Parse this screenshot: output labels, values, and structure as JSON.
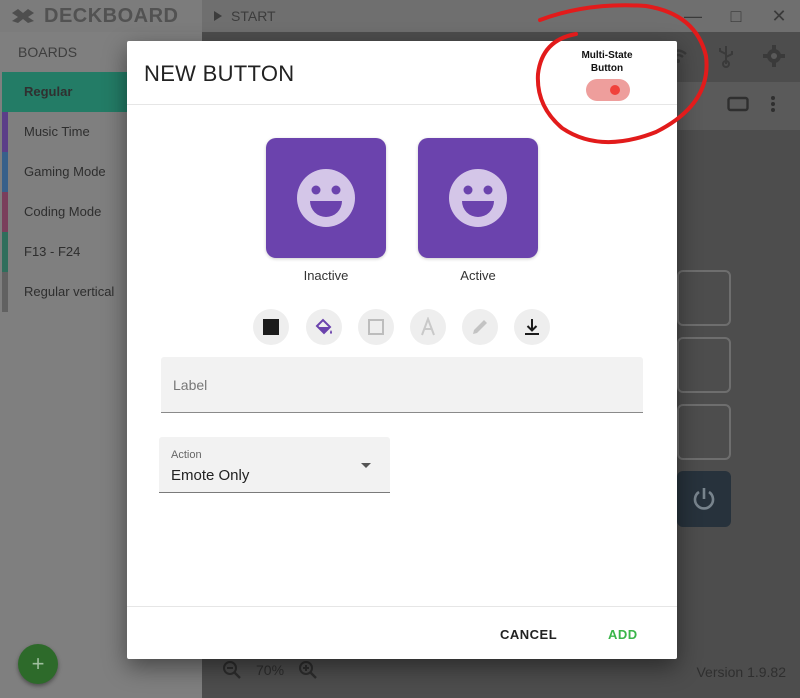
{
  "app": {
    "name": "DECKBOARD",
    "start_label": "START",
    "boards_title": "BOARDS",
    "boards": [
      {
        "label": "Regular",
        "color": "#237c66",
        "active": true
      },
      {
        "label": "Music Time",
        "color": "#5b3e88",
        "active": false
      },
      {
        "label": "Gaming Mode",
        "color": "#37608a",
        "active": false
      },
      {
        "label": "Coding Mode",
        "color": "#7a3f5c",
        "active": false
      },
      {
        "label": "F13 - F24",
        "color": "#2f6e5c",
        "active": false
      },
      {
        "label": "Regular vertical",
        "color": "#616161",
        "active": false
      }
    ],
    "add_board_icon": "+",
    "zoom": "70%",
    "version": "Version 1.9.82"
  },
  "dialog": {
    "title": "NEW BUTTON",
    "multi_state_label": "Multi-State Button",
    "multi_state_on": true,
    "preview_color": "#6b43ad",
    "states": [
      {
        "caption": "Inactive",
        "icon": "smile-icon"
      },
      {
        "caption": "Active",
        "icon": "smile-icon"
      }
    ],
    "tools": [
      "color-square-icon",
      "paint-bucket-icon",
      "border-icon",
      "text-style-icon",
      "pencil-icon",
      "download-icon"
    ],
    "label_placeholder": "Label",
    "action": {
      "caption": "Action",
      "value": "Emote Only"
    },
    "cancel_label": "CANCEL",
    "add_label": "ADD"
  },
  "colors": {
    "accent_green": "#3ab54a",
    "annotation_red": "#e21b1b"
  }
}
